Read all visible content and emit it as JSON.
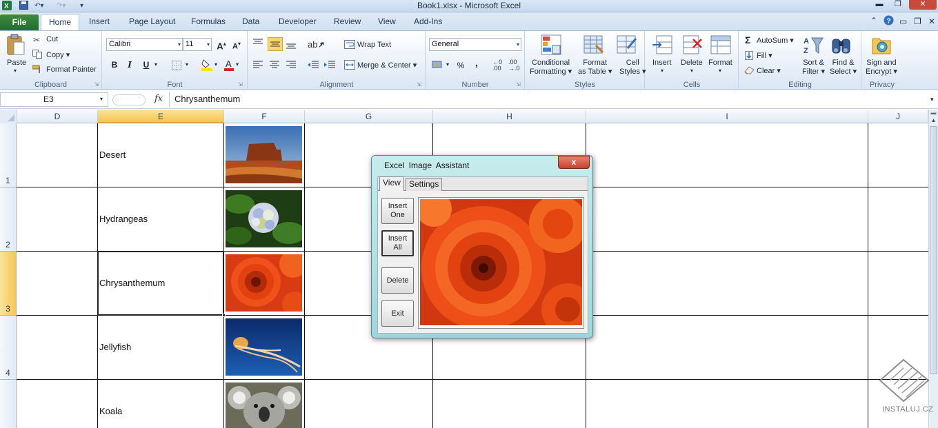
{
  "window": {
    "title": "Book1.xlsx  -  Microsoft Excel"
  },
  "ribbon_tabs": [
    "File",
    "Home",
    "Insert",
    "Page Layout",
    "Formulas",
    "Data",
    "Developer",
    "Review",
    "View",
    "Add-Ins"
  ],
  "clipboard": {
    "paste": "Paste",
    "cut": "Cut",
    "copy": "Copy",
    "format_painter": "Format Painter",
    "group": "Clipboard"
  },
  "font": {
    "name": "Calibri",
    "size": "11",
    "bold": "B",
    "italic": "I",
    "underline": "U",
    "group": "Font"
  },
  "alignment": {
    "wrap_text": "Wrap Text",
    "merge_center": "Merge & Center",
    "group": "Alignment"
  },
  "number": {
    "format": "General",
    "percent": "%",
    "comma": ",",
    "group": "Number"
  },
  "styles": {
    "conditional": [
      "Conditional",
      "Formatting"
    ],
    "format_table": [
      "Format",
      "as Table"
    ],
    "cell_styles": [
      "Cell",
      "Styles"
    ],
    "group": "Styles"
  },
  "cells": {
    "insert": "Insert",
    "delete": "Delete",
    "format": "Format",
    "group": "Cells"
  },
  "editing": {
    "autosum": "AutoSum",
    "fill": "Fill",
    "clear": "Clear",
    "sort_filter": [
      "Sort &",
      "Filter"
    ],
    "find_select": [
      "Find &",
      "Select"
    ],
    "group": "Editing"
  },
  "privacy": {
    "sign_encrypt": [
      "Sign and",
      "Encrypt"
    ],
    "group": "Privacy"
  },
  "formula_bar": {
    "name_box": "E3",
    "fx": "fx",
    "value": "Chrysanthemum"
  },
  "columns": [
    "D",
    "E",
    "F",
    "G",
    "H",
    "I",
    "J"
  ],
  "selected_column": "E",
  "rows": [
    {
      "num": "1",
      "label": "Desert",
      "image": "desert-photo"
    },
    {
      "num": "2",
      "label": "Hydrangeas",
      "image": "hydrangeas-photo"
    },
    {
      "num": "3",
      "label": "Chrysanthemum",
      "image": "chrysanthemum-photo"
    },
    {
      "num": "4",
      "label": "Jellyfish",
      "image": "jellyfish-photo"
    },
    {
      "num": "",
      "label": "Koala",
      "image": "koala-photo"
    }
  ],
  "dialog": {
    "title": "Excel  Image  Assistant",
    "close": "x",
    "tabs": [
      "View",
      "Settings"
    ],
    "buttons": [
      "Insert\nOne",
      "Insert\nAll",
      "Delete",
      "Exit"
    ],
    "preview": "chrysanthemum-photo"
  },
  "watermark": "INSTALUJ.CZ",
  "colors": {
    "selected_header": "#f6c54d",
    "file_tab": "#2c7a32",
    "dialog_frame": "#9ed8da"
  }
}
